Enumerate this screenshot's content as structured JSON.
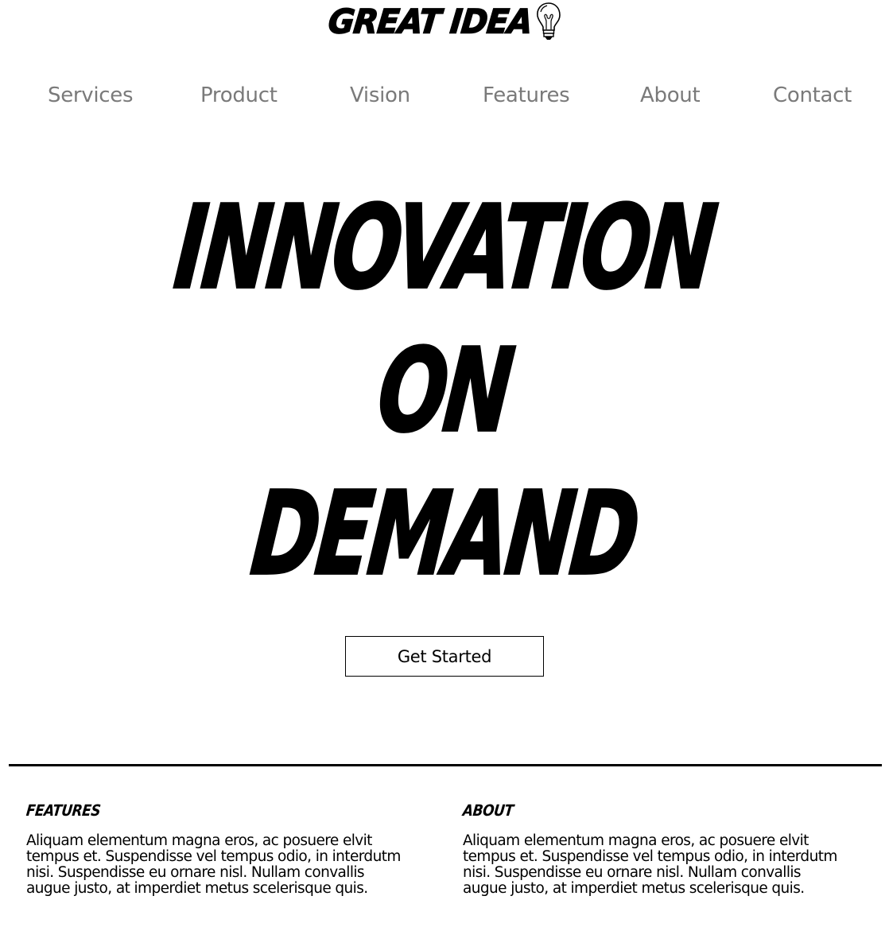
{
  "logo": {
    "text": "GREAT IDEA",
    "icon": "lightbulb-icon"
  },
  "nav": {
    "items": [
      {
        "label": "Services"
      },
      {
        "label": "Product"
      },
      {
        "label": "Vision"
      },
      {
        "label": "Features"
      },
      {
        "label": "About"
      },
      {
        "label": "Contact"
      }
    ]
  },
  "hero": {
    "lines": [
      "INNOVATION",
      "ON",
      "DEMAND"
    ],
    "cta_label": "Get Started"
  },
  "sections": {
    "features": {
      "title": "FEATURES",
      "body": "Aliquam elementum magna eros, ac posuere elvit tempus et. Suspendisse vel tempus odio, in interdutm nisi. Suspendisse eu ornare nisl. Nullam convallis augue justo, at imperdiet metus scelerisque quis."
    },
    "about": {
      "title": "ABOUT",
      "body": "Aliquam elementum magna eros, ac posuere elvit tempus et. Suspendisse vel tempus odio, in interdutm nisi. Suspendisse eu ornare nisl. Nullam convallis augue justo, at imperdiet metus scelerisque quis."
    }
  },
  "colors": {
    "text": "#000000",
    "nav_text": "#7a7a7a",
    "background": "#ffffff"
  }
}
